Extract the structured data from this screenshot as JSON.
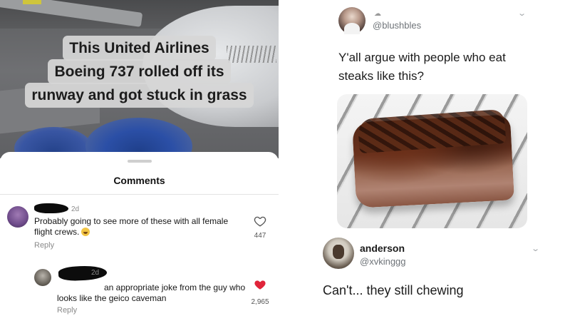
{
  "post": {
    "caption_lines": [
      "This United Airlines",
      "Boeing 737 rolled off its",
      "runway and got stuck in grass"
    ]
  },
  "comments_sheet": {
    "title": "Comments",
    "comments": [
      {
        "time": "2d",
        "text": "Probably going to see more of these with all female flight crews.",
        "emoji": "grinning-face-emoji",
        "reply_label": "Reply",
        "likes": "447",
        "liked": false
      },
      {
        "time": "2d",
        "text": "an appropriate joke from the guy who looks like the geico caveman",
        "reply_label": "Reply",
        "likes": "2,965",
        "liked": true
      }
    ]
  },
  "tweet": {
    "handle": "@blushbles",
    "text": "Y'all argue with people who eat steaks like this?",
    "image": "steak-on-grill-photo"
  },
  "reply_tweet": {
    "name": "anderson",
    "handle": "@xvkinggg",
    "text": "Can't... they still chewing"
  },
  "colors": {
    "caption_bg": "#d6d6d6",
    "liked_heart": "#e0243a",
    "muted_text": "#6e7378"
  }
}
